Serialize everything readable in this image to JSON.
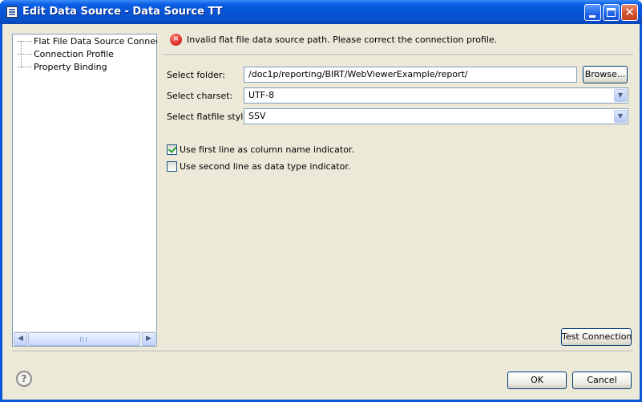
{
  "window": {
    "title": "Edit Data Source - Data Source TT"
  },
  "tree": {
    "items": [
      {
        "label": "Flat File Data Source Connection"
      },
      {
        "label": "Connection Profile"
      },
      {
        "label": "Property Binding"
      }
    ]
  },
  "message": {
    "text": "Invalid flat file data source path. Please correct the connection profile.",
    "icon": "error-icon"
  },
  "form": {
    "folder_label": "Select folder:",
    "folder_value": "/doc1p/reporting/BIRT/WebViewerExample/report/",
    "browse_label": "Browse...",
    "charset_label": "Select charset:",
    "charset_value": "UTF-8",
    "style_label": "Select flatfile style:",
    "style_value": "SSV",
    "first_line_label": "Use first line as column name indicator.",
    "first_line_checked": true,
    "second_line_label": "Use second line as data type indicator.",
    "second_line_checked": false,
    "test_connection_label": "Test Connection"
  },
  "footer": {
    "ok_label": "OK",
    "cancel_label": "Cancel"
  },
  "colors": {
    "titlebar": "#0a57d8",
    "dialog_bg": "#ece9d8",
    "error": "#e2322a",
    "check": "#21a121"
  }
}
